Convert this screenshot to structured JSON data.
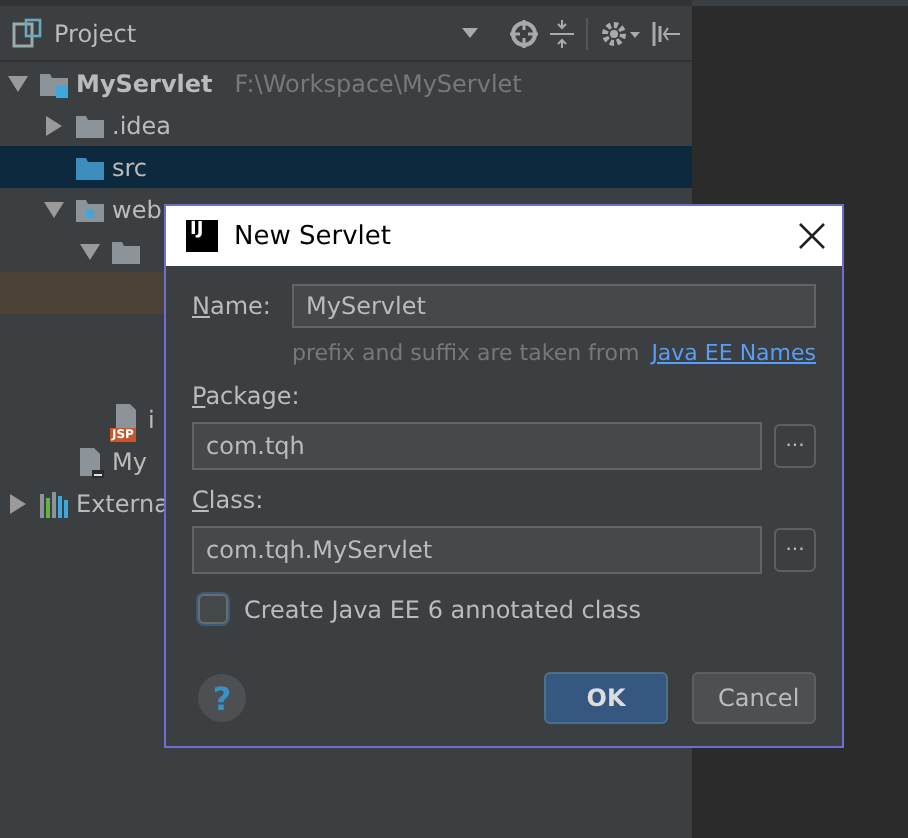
{
  "project_panel": {
    "title": "Project"
  },
  "tree": [
    {
      "name": "MyServlet",
      "path": "F:\\Workspace\\MyServlet",
      "kind": "module",
      "expanded": true,
      "selected": false,
      "children": [
        {
          "name": ".idea",
          "kind": "folder",
          "expanded": false,
          "selected": false
        },
        {
          "name": "src",
          "kind": "source",
          "selected": true
        },
        {
          "name": "web",
          "kind": "web",
          "expanded": true,
          "selected": false,
          "children": [
            {
              "kind": "folder",
              "expanded": true,
              "selected": false,
              "children": [
                {
                  "selected": false,
                  "highlighted": true
                }
              ]
            },
            {
              "name": "i",
              "kind": "jsp",
              "badge": "JSP",
              "selected": false
            }
          ]
        },
        {
          "name": "My",
          "kind": "file",
          "selected": false
        }
      ]
    },
    {
      "name": "Externa",
      "kind": "libraries",
      "expanded": false,
      "selected": false
    }
  ],
  "dialog": {
    "logo": "IJ",
    "title": "New Servlet",
    "name": {
      "label": "Name:",
      "value": "MyServlet"
    },
    "hint": "prefix and suffix are taken from",
    "hint_link": "Java EE Names",
    "package": {
      "label": "Package:",
      "value": "com.tqh",
      "browse": "..."
    },
    "class": {
      "label": "Class:",
      "value": "com.tqh.MyServlet",
      "browse": "..."
    },
    "checkbox": {
      "label": "Create Java EE 6 annotated class",
      "checked": false
    },
    "help": "?",
    "buttons": [
      {
        "label": "OK",
        "kind": "default"
      },
      {
        "label": "Cancel",
        "kind": "normal"
      }
    ]
  }
}
